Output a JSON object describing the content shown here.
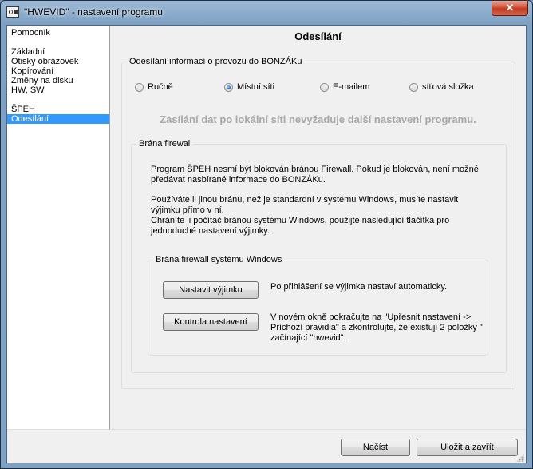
{
  "window": {
    "title": "\"HWEVID\" - nastavení programu",
    "close_label": "✕"
  },
  "sidebar": {
    "items": [
      {
        "label": "Pomocník",
        "selected": false
      },
      {
        "label": "Základní",
        "selected": false
      },
      {
        "label": "Otisky obrazovek",
        "selected": false
      },
      {
        "label": "Kopírování",
        "selected": false
      },
      {
        "label": "Změny na disku",
        "selected": false
      },
      {
        "label": "HW, SW",
        "selected": false
      },
      {
        "label": "ŠPEH",
        "selected": false
      },
      {
        "label": "Odesílání",
        "selected": true
      }
    ]
  },
  "main": {
    "title": "Odesílání",
    "send_group": {
      "legend": "Odesílání informací o provozu do BONZÁKu",
      "options": [
        {
          "label": "Ručně",
          "checked": false
        },
        {
          "label": "Místní síti",
          "checked": true
        },
        {
          "label": "E-mailem",
          "checked": false
        },
        {
          "label": "síťová složka",
          "checked": false
        }
      ],
      "hint": "Zasílání dat po lokální síti nevyžaduje další nastavení programu."
    },
    "firewall_group": {
      "legend": "Brána firewall",
      "para1": "Program ŠPEH nesmí být blokován bránou Firewall. Pokud je blokován, není možné předávat nasbírané informace do BONZÁKu.",
      "para2": "Používáte li jinou bránu, než je standardní v systému Windows, musíte nastavit výjimku přímo v ní.",
      "para3": "Chráníte li počítač bránou systému Windows, použijte následující tlačítka pro jednoduché nastavení výjimky.",
      "windows_group": {
        "legend": "Brána firewall systému Windows",
        "set_exception_label": "Nastavit výjimku",
        "set_exception_desc": "Po přihlášení se výjimka nastaví automaticky.",
        "check_settings_label": "Kontrola nastavení",
        "check_settings_desc": "V novém okně pokračujte na \"Upřesnit nastavení -> Příchozí pravidla\" a zkontrolujte, že existují 2 položky \" začínající \"hwevid\"."
      }
    }
  },
  "footer": {
    "load_label": "Načíst",
    "save_close_label": "Uložit a zavřít"
  }
}
